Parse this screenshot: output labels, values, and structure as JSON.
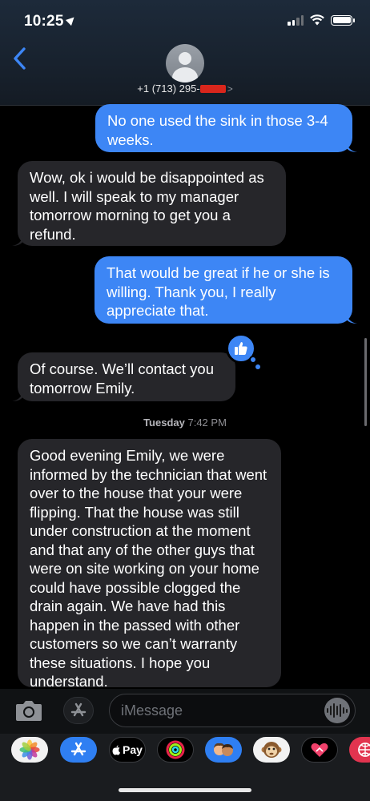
{
  "status_bar": {
    "time": "10:25"
  },
  "header": {
    "contact_prefix": "+1 (713) 295-",
    "contact_suffix": ">"
  },
  "messages": [
    {
      "side": "sent",
      "text": "No one used the sink in those 3-4 weeks."
    },
    {
      "side": "received",
      "text": "Wow, ok i would be disappointed as well. I will speak to my manager tomorrow morning to get you a refund."
    },
    {
      "side": "sent",
      "text": "That would be great if he or she is willing. Thank you, I really appreciate that."
    },
    {
      "side": "received",
      "text": "Of course. We’ll contact you tomorrow Emily.",
      "tapback": "thumbs-up"
    },
    {
      "side": "received",
      "text": "Good evening Emily, we were informed by the technician that went over to the house that your were flipping. That the house was still under construction at the moment and that any of the other guys that were on site working on your home could have possible clogged the drain again. We have had this happen in the passed with other customers so we can’t warranty these situations. I hope you understand."
    }
  ],
  "timestamp": {
    "day": "Tuesday",
    "time": "7:42 PM"
  },
  "compose": {
    "placeholder": "iMessage"
  },
  "app_drawer": {
    "items": [
      "photos-icon",
      "app-store-icon",
      "apple-pay-icon",
      "activity-icon",
      "memoji-icon",
      "animoji-monkey-icon",
      "digital-touch-icon",
      "web-search-icon"
    ],
    "apple_pay_label": "Pay"
  },
  "colors": {
    "sent": "#3d86f5",
    "received": "#26262a",
    "background": "#000000"
  }
}
